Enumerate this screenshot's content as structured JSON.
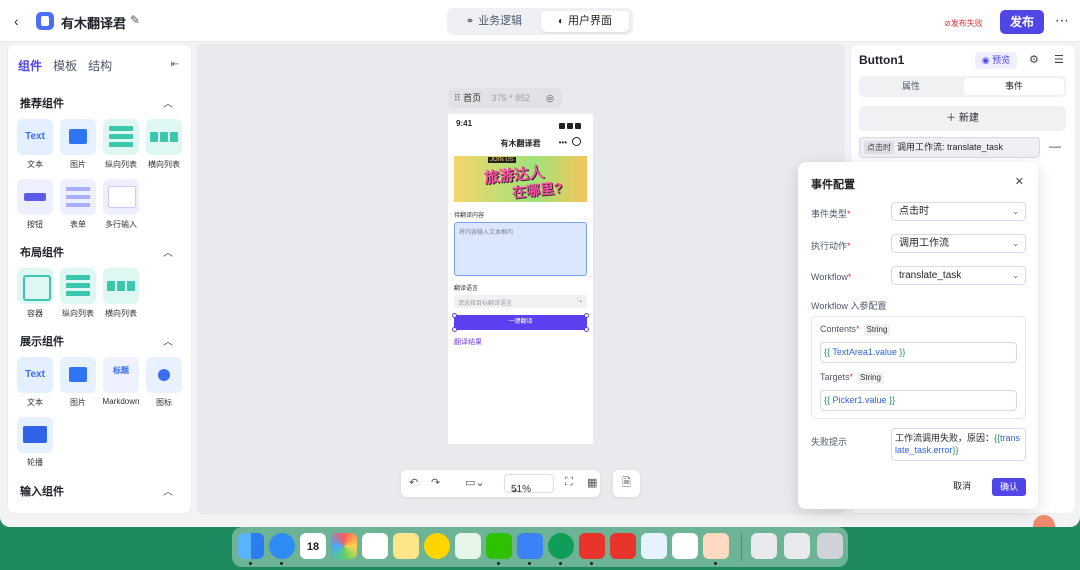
{
  "header": {
    "app_title": "有木翻译君",
    "mode_tabs": [
      "业务逻辑",
      "用户界面"
    ],
    "fail_badge": "发布失败",
    "publish_label": "发布"
  },
  "left_panel": {
    "tabs": [
      "组件",
      "模板",
      "结构"
    ],
    "sections": [
      {
        "title": "推荐组件",
        "items": [
          "文本",
          "图片",
          "纵向列表",
          "横向列表",
          "按钮",
          "表单",
          "多行输入"
        ]
      },
      {
        "title": "布局组件",
        "items": [
          "容器",
          "纵向列表",
          "横向列表"
        ]
      },
      {
        "title": "展示组件",
        "items": [
          "文本",
          "图片",
          "Markdown",
          "图标",
          "轮播"
        ]
      },
      {
        "title": "输入组件",
        "items": []
      }
    ],
    "text_tile": "Text",
    "md_tile": "标题"
  },
  "canvas": {
    "page_name": "首页",
    "page_size": "375 * 852",
    "phone": {
      "time": "9:41",
      "title": "有木翻译君",
      "menu": "•••",
      "banner_tag": "JOIN US",
      "banner_line1": "旅游达人",
      "banner_line2": "在哪里?",
      "input_label": "待翻译内容",
      "textarea_placeholder": "将内容输入文本框内",
      "lang_label": "翻译语言",
      "picker_placeholder": "请选择目标翻译语言",
      "button_label": "一键翻译",
      "result_label": "翻译结果"
    },
    "zoom": "51%"
  },
  "right_panel": {
    "title": "Button1",
    "preview_label": "预览",
    "tabs": [
      "属性",
      "事件"
    ],
    "new_label": "新建",
    "event_chip": "点击时",
    "event_text": "调用工作流: translate_task"
  },
  "modal": {
    "title": "事件配置",
    "event_type_label": "事件类型",
    "event_type_value": "点击时",
    "action_label": "执行动作",
    "action_value": "调用工作流",
    "workflow_label": "Workflow",
    "workflow_value": "translate_task",
    "params_title": "Workflow 入参配置",
    "params": [
      {
        "name": "Contents",
        "type": "String",
        "var": "TextArea1.value"
      },
      {
        "name": "Targets",
        "type": "String",
        "var": "Picker1.value"
      }
    ],
    "fail_label": "失败提示",
    "fail_prefix": "工作流调用失败，原因：",
    "fail_var": "translate_task.error",
    "open_brace": "{{",
    "close_brace": "}}",
    "cancel_label": "取消",
    "ok_label": "确认"
  },
  "dock": {
    "calendar_day": "18",
    "calendar_month": "DEC"
  }
}
